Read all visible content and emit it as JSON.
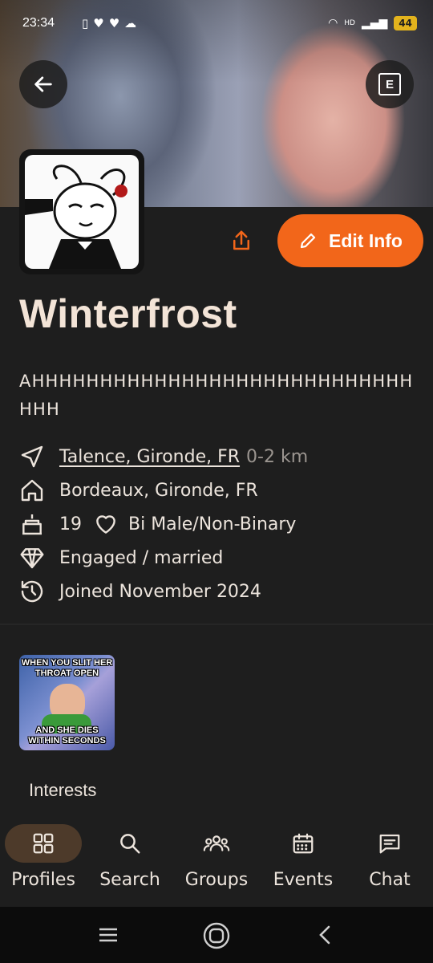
{
  "status_bar": {
    "time": "23:34",
    "battery": "44",
    "network": "HD"
  },
  "header": {
    "back_icon": "arrow-left-icon",
    "menu_icon": "e-box-icon",
    "menu_letter": "E"
  },
  "profile": {
    "name": "Winterfrost",
    "bio": "AHHHHHHHHHHHHHHHHHHHHHHHHHHHHHHH",
    "edit_label": "Edit Info",
    "location_current": "Talence, Gironde, FR",
    "distance": "0-2 km",
    "hometown": "Bordeaux, Gironde, FR",
    "age": "19",
    "orientation": "Bi Male/Non-Binary",
    "relationship": "Engaged / married",
    "joined": "Joined November 2024"
  },
  "gallery": {
    "meme_top": "WHEN YOU SLIT HER THROAT OPEN",
    "meme_bottom": "AND SHE DIES WITHIN SECONDS"
  },
  "sections": {
    "interests_title": "Interests"
  },
  "nav": {
    "items": [
      {
        "label": "Profiles",
        "icon": "grid-icon",
        "active": true
      },
      {
        "label": "Search",
        "icon": "search-icon",
        "active": false
      },
      {
        "label": "Groups",
        "icon": "people-icon",
        "active": false
      },
      {
        "label": "Events",
        "icon": "calendar-icon",
        "active": false
      },
      {
        "label": "Chat",
        "icon": "chat-icon",
        "active": false
      }
    ]
  },
  "colors": {
    "accent": "#f2661a",
    "background": "#1e1e1e",
    "text": "#ece4dc",
    "active_pill": "#4d3a2a"
  }
}
